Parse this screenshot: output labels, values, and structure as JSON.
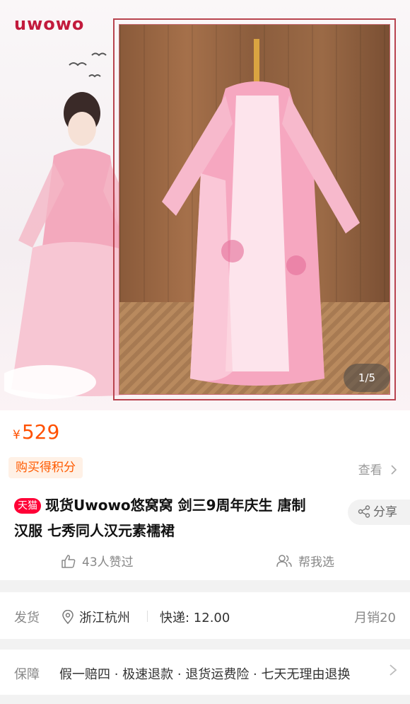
{
  "brand": {
    "logo_text": "uwowo"
  },
  "gallery": {
    "counter": "1/5"
  },
  "price": {
    "currency": "¥",
    "amount": "529"
  },
  "info": {
    "points_label": "购买得积分",
    "view_label": "查看",
    "tmall_badge": "天猫",
    "title_line1": "现货Uwowo悠窝窝 剑三9周年庆生 唐制",
    "title_line2": "汉服 七秀同人汉元素襦裙",
    "share_label": "分享",
    "likes_label": "43人赞过",
    "help_label": "帮我选"
  },
  "delivery": {
    "label": "发货",
    "location": "浙江杭州",
    "shipping": "快递: 12.00",
    "monthly_sales": "月销20"
  },
  "guarantee": {
    "label": "保障",
    "text": "假一赔四 · 极速退款 · 退货运费险 · 七天无理由退换"
  },
  "colors": {
    "price": "#ff5000",
    "tmall": "#ff0036",
    "brand": "#c21a3c"
  }
}
